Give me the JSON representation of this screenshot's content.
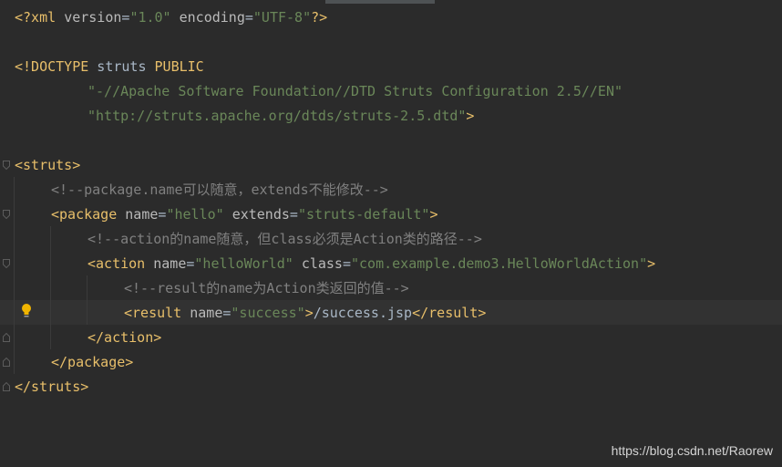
{
  "editor": {
    "language": "xml",
    "colors": {
      "background": "#2b2b2b",
      "tag": "#e8bf6a",
      "attribute": "#bababa",
      "value": "#6a8759",
      "comment": "#808080",
      "text": "#a9b7c6"
    },
    "gutter_icons": [
      "fold-marker-icon",
      "lightbulb-icon"
    ],
    "lines": [
      {
        "xml_decl_open": "<?xml",
        "sp1": " ",
        "version_attr": "version",
        "eq1": "=",
        "version_val": "\"1.0\"",
        "sp2": " ",
        "encoding_attr": "encoding",
        "eq2": "=",
        "encoding_val": "\"UTF-8\"",
        "xml_decl_close": "?>"
      },
      {},
      {
        "doctype_open": "<!DOCTYPE",
        "doctype_name": " struts ",
        "doctype_public": "PUBLIC"
      },
      {
        "public_id": "\"-//Apache Software Foundation//DTD Struts Configuration 2.5//EN\""
      },
      {
        "system_id": "\"http://struts.apache.org/dtds/struts-2.5.dtd\"",
        "doctype_close": ">"
      },
      {},
      {
        "tag": "<struts>"
      },
      {
        "comment": "<!--package.name可以随意，extends不能修改-->"
      },
      {
        "tag_open": "<package",
        "sp1": " ",
        "name_attr": "name",
        "eq1": "=",
        "name_val": "\"hello\"",
        "sp2": " ",
        "extends_attr": "extends",
        "eq2": "=",
        "extends_val": "\"struts-default\"",
        "tag_close": ">"
      },
      {
        "comment": "<!--action的name随意，但class必须是Action类的路径-->"
      },
      {
        "tag_open": "<action",
        "sp1": " ",
        "name_attr": "name",
        "eq1": "=",
        "name_val": "\"helloWorld\"",
        "sp2": " ",
        "class_attr": "class",
        "eq2": "=",
        "class_val": "\"com.example.demo3.HelloWorldAction\"",
        "tag_close": ">"
      },
      {
        "comment": "<!--result的name为Action类返回的值-->"
      },
      {
        "tag_open": "<result",
        "sp1": " ",
        "name_attr": "name",
        "eq1": "=",
        "name_val": "\"success\"",
        "tag_close": ">",
        "text": "/success.jsp",
        "end_tag": "</result>"
      },
      {
        "tag": "</action>"
      },
      {
        "tag": "</package>"
      },
      {
        "tag": "</struts>"
      }
    ]
  },
  "watermark": "https://blog.csdn.net/Raorew"
}
